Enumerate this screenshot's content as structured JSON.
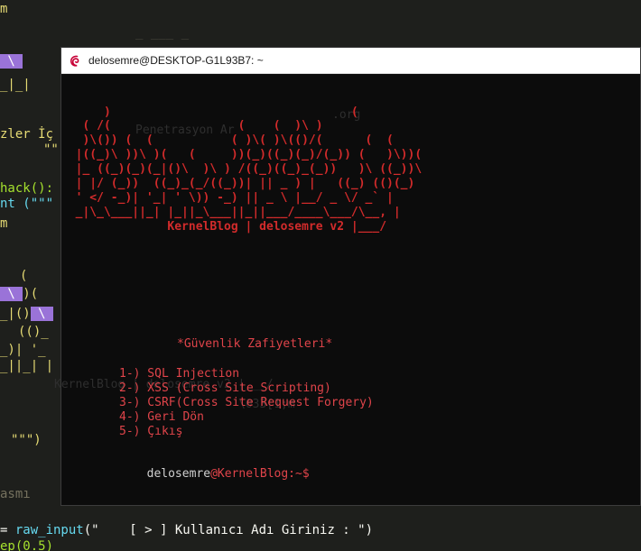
{
  "editor": {
    "lines": {
      "l1": "m",
      "l3": "_|_|",
      "l4": "zler İç",
      "l5": "\"\"",
      "l6": "hack():",
      "l7": "nt (\"\"\"",
      "l8": "m",
      "l9": "(",
      "l10": "_|()",
      "l11": "(()_",
      "l12": "_)| '_",
      "l13": "_||_| |",
      "l14": "\"\"\")",
      "l15": "asmı",
      "l16_pre": "= ",
      "l16_fn": "raw_input",
      "l16_str": "(\"    [ > ] Kullanıcı Adı Giriniz : \")",
      "l17": "ep(0.5)"
    },
    "ghost": {
      "g1": "_ ___ _",
      "g2": ".org",
      "g3": "Penetrasyon Ar",
      "g4": "KernelBlog | delosemre v2 |___/",
      "g5": "\\033[1;m"
    }
  },
  "terminal": {
    "title": "delosemre@DESKTOP-G1L93B7: ~",
    "ascii_art": [
      "      )                                  (",
      "   ( /(                  (    (  )\\ )",
      "   )\\()) (  (           ( )\\( )\\(()/(      (  (",
      "  |((_)\\ ))\\ )(   (     ))(_)((_)(_)/(_)) (   )\\))(",
      "  |_ ((_)(_)(_|()\\  )\\ ) /((_)((_)_(_))   )\\ ((_))\\",
      "  | |/ (_))  ((_)_(_/((_))| || _ ) |   ((_) (()(_)",
      "  ' </ -_)| '_| ' \\)) -_) || _ \\ |__/ _ \\/ _` |",
      "  _|\\_\\___||_| |_||_\\___||_||___/____\\___/\\__, |",
      "               KernelBlog | delosemre v2 |___/"
    ],
    "menu_title": "*Güvenlik Zafiyetleri*",
    "menu_items": [
      "1-) SQL Injection",
      "2-) XSS (Cross Site Scripting)",
      "3-) CSRF(Cross Site Request Forgery)",
      "4-) Geri Dön",
      "5-) Çıkış"
    ],
    "prompt_user": "delosemre",
    "prompt_host": "@KernelBlog:~$"
  },
  "colors": {
    "ascii_red": "#d22b2b",
    "menu_red": "#e0444a",
    "terminal_bg": "#0c0c0c",
    "editor_bg": "#1e1f1c",
    "highlight": "#9a73d8"
  }
}
